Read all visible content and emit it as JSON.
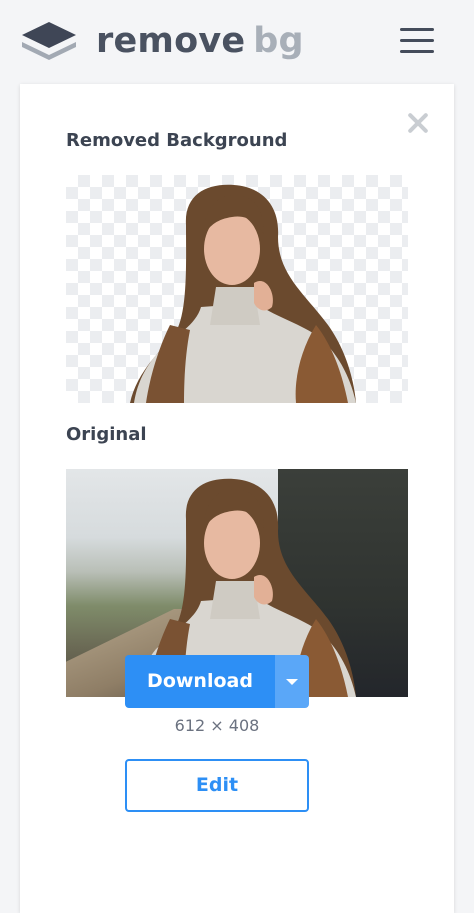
{
  "header": {
    "brand_part1": "remove",
    "brand_part2": "bg"
  },
  "result": {
    "removed_title": "Removed Background",
    "original_title": "Original",
    "download_label": "Download",
    "dimensions": "612 × 408",
    "edit_label": "Edit"
  },
  "colors": {
    "accent": "#2d8ff5",
    "accent_light": "#5aa7f8",
    "text_dark": "#3c4452",
    "brand_gray": "#a8afb8"
  },
  "icons": {
    "logo": "layers-icon",
    "menu": "hamburger-menu-icon",
    "close": "close-icon",
    "dropdown": "chevron-down-icon"
  }
}
